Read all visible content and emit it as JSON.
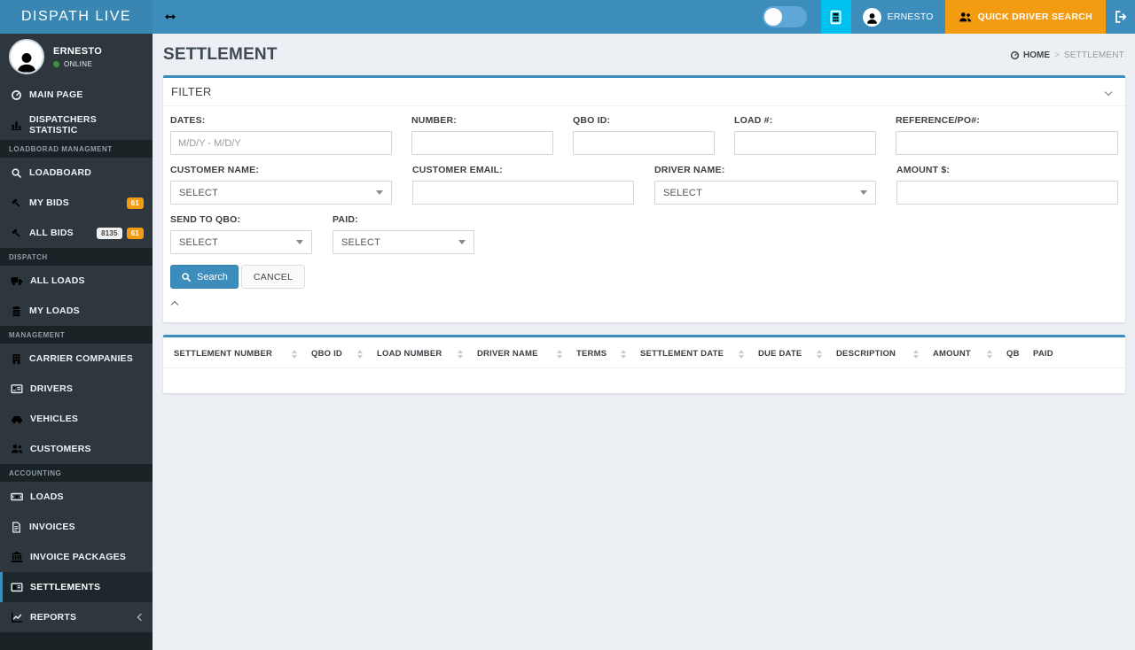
{
  "theme": {
    "colors": {
      "navbar_bg": "#3c8dbc",
      "logo_bg": "#3a86b3",
      "cyan": "#00c0ef",
      "orange": "#f39c12",
      "sidebar_bg": "#2d373d",
      "section_bg": "#1a2226",
      "active_bg": "#1e282c",
      "accent": "#3c8dbc",
      "content_bg": "#ecf0f5",
      "green": "#3f9142",
      "input_border": "#d2d6de"
    }
  },
  "navbar": {
    "logo_text": "DISPATH LIVE",
    "collapse_icon": "arrows-horizontal-icon",
    "toggle_on": false,
    "calculator_icon": "calculator-icon",
    "user_name": "ERNESTO",
    "quick_driver_search_label": "QUICK DRIVER SEARCH",
    "logout_icon": "sign-out-icon"
  },
  "sidebar": {
    "user": {
      "name": "ERNESTO",
      "status": "ONLINE"
    },
    "sections": [
      {
        "header": "",
        "items": [
          {
            "label": "MAIN PAGE",
            "icon": "dashboard-icon"
          },
          {
            "label": "DISPATCHERS STATISTIC",
            "icon": "bar-chart-icon"
          }
        ]
      },
      {
        "header": "LOADBORAD MANAGMENT",
        "items": [
          {
            "label": "LOADBOARD",
            "icon": "search-icon"
          },
          {
            "label": "MY BIDS",
            "icon": "gavel-icon",
            "badges": [
              {
                "text": "61",
                "style": "orange"
              }
            ]
          },
          {
            "label": "ALL BIDS",
            "icon": "gavel-icon",
            "badges": [
              {
                "text": "8135",
                "style": "light"
              },
              {
                "text": "61",
                "style": "orange"
              }
            ]
          }
        ]
      },
      {
        "header": "DISPATCH",
        "items": [
          {
            "label": "ALL LOADS",
            "icon": "truck-icon"
          },
          {
            "label": "MY LOADS",
            "icon": "database-icon"
          }
        ]
      },
      {
        "header": "MANAGEMENT",
        "items": [
          {
            "label": "CARRIER COMPANIES",
            "icon": "building-icon"
          },
          {
            "label": "DRIVERS",
            "icon": "id-card-icon"
          },
          {
            "label": "VEHICLES",
            "icon": "car-icon"
          },
          {
            "label": "CUSTOMERS",
            "icon": "users-icon"
          }
        ]
      },
      {
        "header": "ACCOUNTING",
        "items": [
          {
            "label": "LOADS",
            "icon": "money-icon"
          },
          {
            "label": "INVOICES",
            "icon": "invoice-icon"
          },
          {
            "label": "INVOICE PACKAGES",
            "icon": "bank-icon"
          },
          {
            "label": "SETTLEMENTS",
            "icon": "settlement-card-icon",
            "active": true
          },
          {
            "label": "REPORTS",
            "icon": "line-chart-icon",
            "has_submenu": true
          }
        ]
      }
    ]
  },
  "page": {
    "title": "SETTLEMENT",
    "breadcrumb": {
      "home_icon": "dashboard-icon",
      "home": "HOME",
      "separator": ">",
      "current": "SETTLEMENT"
    }
  },
  "filter": {
    "title": "FILTER",
    "fields": {
      "dates": {
        "label": "DATES:",
        "placeholder": "M/D/Y - M/D/Y",
        "value": ""
      },
      "number": {
        "label": "NUMBER:",
        "value": ""
      },
      "qbo_id": {
        "label": "QBO ID:",
        "value": ""
      },
      "load": {
        "label": "LOAD #:",
        "value": ""
      },
      "reference": {
        "label": "REFERENCE/PO#:",
        "value": ""
      },
      "customer_name": {
        "label": "CUSTOMER NAME:",
        "value": "SELECT"
      },
      "customer_email": {
        "label": "CUSTOMER EMAIL:",
        "value": ""
      },
      "driver_name": {
        "label": "DRIVER NAME:",
        "value": "SELECT"
      },
      "amount": {
        "label": "AMOUNT $:",
        "value": ""
      },
      "send_to_qbo": {
        "label": "SEND TO QBO:",
        "value": "SELECT"
      },
      "paid": {
        "label": "PAID:",
        "value": "SELECT"
      }
    },
    "search_label": "Search",
    "cancel_label": "CANCEL"
  },
  "table": {
    "columns": [
      {
        "label": "SETTLEMENT NUMBER",
        "sortable": true
      },
      {
        "label": "QBO ID",
        "sortable": true
      },
      {
        "label": "LOAD NUMBER",
        "sortable": true
      },
      {
        "label": "DRIVER NAME",
        "sortable": true
      },
      {
        "label": "TERMS",
        "sortable": true
      },
      {
        "label": "SETTLEMENT DATE",
        "sortable": true
      },
      {
        "label": "DUE DATE",
        "sortable": true
      },
      {
        "label": "DESCRIPTION",
        "sortable": true
      },
      {
        "label": "AMOUNT",
        "sortable": true
      },
      {
        "label": "QB",
        "sortable": false
      },
      {
        "label": "PAID",
        "sortable": false
      }
    ],
    "rows": []
  }
}
